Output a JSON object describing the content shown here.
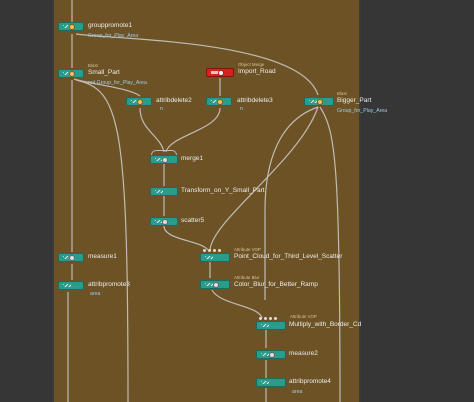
{
  "colors": {
    "network_bg": "#6c5225",
    "side_panel": "#363636",
    "node_teal": "#2a9c8a",
    "node_red": "#d42420",
    "wire": "#cfcfcf",
    "group_text": "#9ecde8"
  },
  "nodes": {
    "grouppromote1": {
      "name": "grouppromote1",
      "sub": "Group_for_Play_Area"
    },
    "small_part": {
      "type": "Blast",
      "name": "Small_Part",
      "sub": "not Group_for_Play_Area"
    },
    "import_road": {
      "type": "Object Merge",
      "name": "Import_Road"
    },
    "attribdelete2": {
      "name": "attribdelete2",
      "sub": "n"
    },
    "attribdelete3": {
      "name": "attribdelete3",
      "sub": "n"
    },
    "bigger_part": {
      "type": "Blast",
      "name": "Bigger_Part",
      "sub": "Group_for_Play_Area"
    },
    "merge1": {
      "name": "merge1"
    },
    "transform": {
      "name": "Transform_on_Y_Small_Part"
    },
    "scatter5": {
      "name": "scatter5"
    },
    "measure1": {
      "name": "measure1"
    },
    "point_cloud": {
      "type": "Attribute VOP",
      "name": "Point_Cloud_for_Third_Level_Scatter"
    },
    "attribpromote3": {
      "name": "attribpromote3",
      "sub": "area"
    },
    "color_blur": {
      "type": "Attribute Blur",
      "name": "Color_Blur_for_Better_Ramp"
    },
    "multiply": {
      "type": "Attribute VOP",
      "name": "Multiply_with_Border_Cd"
    },
    "measure2": {
      "name": "measure2"
    },
    "attribpromote4": {
      "name": "attribpromote4",
      "sub": "area"
    }
  }
}
